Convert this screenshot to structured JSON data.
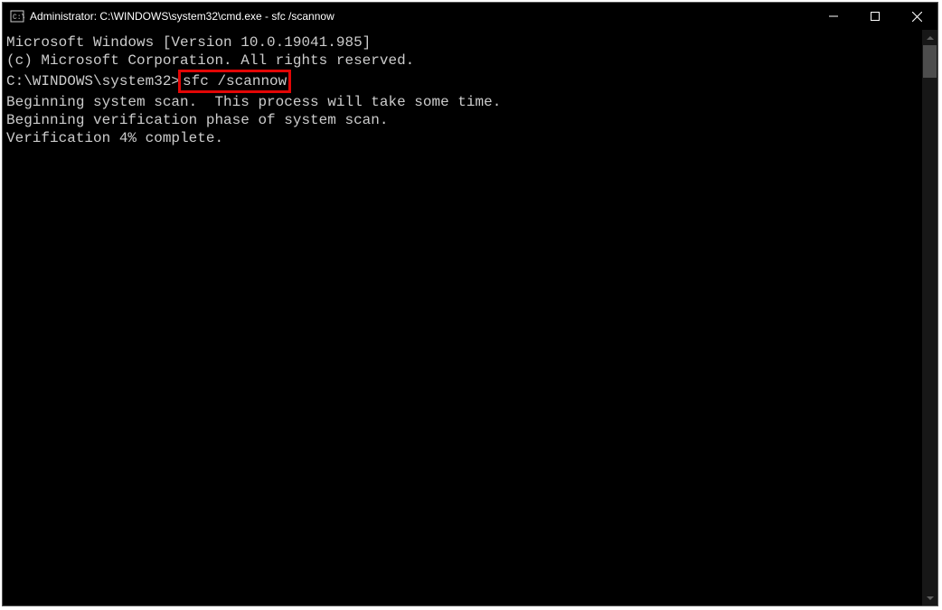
{
  "window": {
    "title": "Administrator: C:\\WINDOWS\\system32\\cmd.exe - sfc  /scannow"
  },
  "terminal": {
    "line1": "Microsoft Windows [Version 10.0.19041.985]",
    "line2": "(c) Microsoft Corporation. All rights reserved.",
    "blank1": "",
    "prompt": "C:\\WINDOWS\\system32>",
    "command": "sfc /scannow",
    "blank2": "",
    "line3": "Beginning system scan.  This process will take some time.",
    "blank3": "",
    "line4": "Beginning verification phase of system scan.",
    "line5": "Verification 4% complete."
  }
}
